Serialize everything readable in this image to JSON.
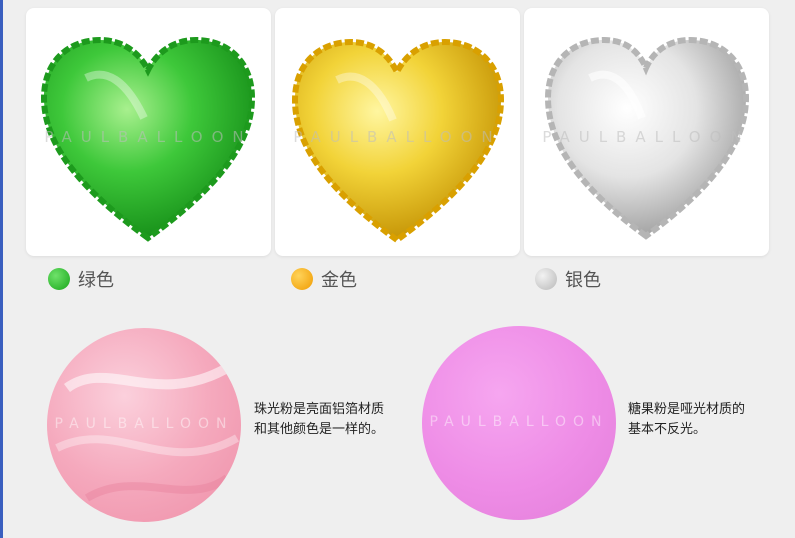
{
  "watermark": "PAULBALLOON",
  "balloons": [
    {
      "label": "绿色",
      "color": "#22b024"
    },
    {
      "label": "金色",
      "color": "#f5a300"
    },
    {
      "label": "银色",
      "color": "#c9c9c9"
    }
  ],
  "materials": [
    {
      "color": "#f4a8bd",
      "line1": "珠光粉是亮面铝箔材质",
      "line2": "和其他颜色是一样的。"
    },
    {
      "color": "#ee8ce6",
      "line1": "糖果粉是哑光材质的",
      "line2": "基本不反光。"
    }
  ]
}
